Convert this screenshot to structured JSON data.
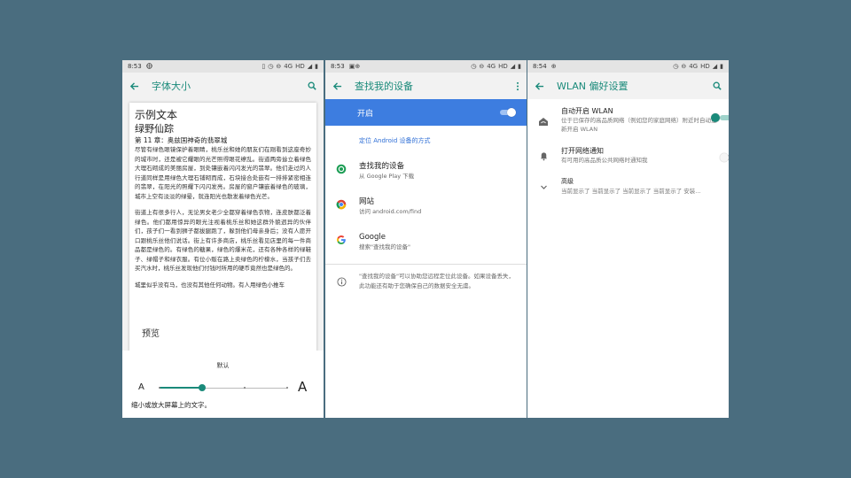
{
  "panel1": {
    "status": {
      "time": "8:53",
      "network": "4G",
      "hd": "HD"
    },
    "title": "字体大小",
    "sample_title": "示例文本",
    "book_title": "绿野仙踪",
    "chapter": "第 11 章：奥兹国神奇的翡翠城",
    "para1": "尽管有绿色眼镜保护着眼睛，桃乐丝和她的朋友们在刚看到这座奇妙的城市时，还是被它耀眼的光芒照得眼花缭乱。街道两旁耸立着绿色大理石砌成的美丽房屋，到处镶嵌着闪闪发光的翡翠。他们走过的人行道同样是用绿色大理石铺砌而成，石块接合处嵌有一排排紧密相连的翡翠，在阳光的照耀下闪闪发亮。房屋的窗户镶嵌着绿色的玻璃，城市上空有淡淡的绿晕，就连阳光也散发着绿色光芒。",
    "para2": "街道上有很多行人，无论男女老少全都穿着绿色衣物，连皮肤都泛着绿色。他们都用惊异的眼光注视着桃乐丝和她这群外貌迥异的伙伴们，孩子们一看到狮子都拔腿跑了，躲到他们母亲身后；没有人愿开口跟桃乐丝他们说话。街上有许多商店，桃乐丝看见店里的每一件商品都是绿色的。有绿色的糖果，绿色的爆米花，还有各种各样的绿鞋子、绿帽子和绿衣服。有位小贩在路上卖绿色的柠檬水，当孩子们去买汽水时，桃乐丝发现他们付钱时所用的硬币竟然也是绿色的。",
    "para3": "城里似乎没有马，也没有其他任何动物。有人用绿色小推车",
    "preview_label": "预览",
    "size_default": "默认",
    "small_a": "A",
    "large_a": "A",
    "hint": "缩小或放大屏幕上的文字。",
    "slider": {
      "positions": 4,
      "selected_index": 1
    }
  },
  "panel2": {
    "status": {
      "time": "8:53",
      "network": "4G",
      "hd": "HD"
    },
    "title": "查找我的设备",
    "master_label": "开启",
    "master_on": true,
    "locate_link": "定位 Android 设备的方式",
    "items": [
      {
        "title": "查找我的设备",
        "subtitle": "从 Google Play 下载",
        "icon": "find-device-icon"
      },
      {
        "title": "网站",
        "subtitle": "访问 android.com/find",
        "icon": "chrome-icon"
      },
      {
        "title": "Google",
        "subtitle": "搜索\"查找我的设备\"",
        "icon": "google-icon"
      }
    ],
    "info": "\"查找我的设备\"可以协助您远程定位此设备。如果设备丢失，此功能还有助于您确保自己的数据安全无虞。"
  },
  "panel3": {
    "status": {
      "time": "8:54",
      "network": "4G",
      "hd": "HD"
    },
    "title": "WLAN 偏好设置",
    "items": [
      {
        "title": "自动开启 WLAN",
        "subtitle": "位于已保存的高品质网络（例如您的家庭网络）附近时自动重新开启 WLAN",
        "on": true
      },
      {
        "title": "打开网络通知",
        "subtitle": "有可用的高品质公共网络时通知我",
        "on": false
      }
    ],
    "advanced_title": "高级",
    "advanced_subtitle": "当前显示了 当前显示了 当前显示了 当前显示了 安装..."
  },
  "colors": {
    "accent": "#1a8a7a",
    "blue": "#3d7de0",
    "background": "#4a6d7f"
  }
}
